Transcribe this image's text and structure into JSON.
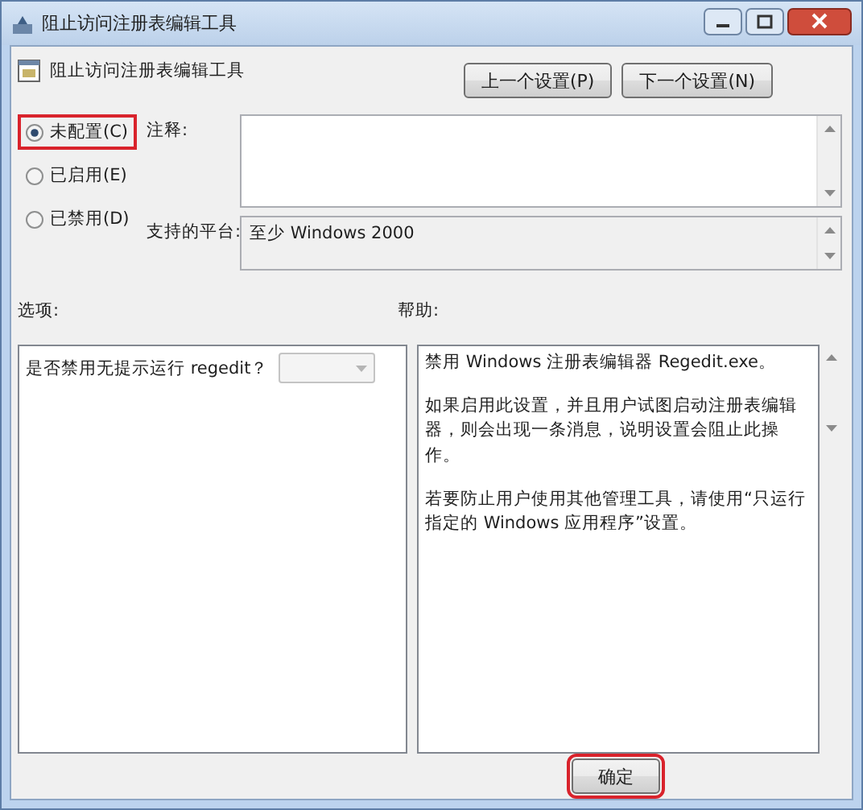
{
  "window": {
    "title": "阻止访问注册表编辑工具"
  },
  "heading": "阻止访问注册表编辑工具",
  "nav_buttons": [
    "上一个设置(P)",
    "下一个设置(N)"
  ],
  "state_options": [
    {
      "label": "未配置(C)",
      "selected": true,
      "highlighted": true
    },
    {
      "label": "已启用(E)",
      "selected": false,
      "highlighted": false
    },
    {
      "label": "已禁用(D)",
      "selected": false,
      "highlighted": false
    }
  ],
  "comment": {
    "label": "注释:"
  },
  "platform": {
    "label": "支持的平台:",
    "value": "至少 Windows 2000"
  },
  "options": {
    "label": "选项:",
    "items": [
      {
        "label": "是否禁用无提示运行 regedit？",
        "disabled": true
      }
    ]
  },
  "help": {
    "label": "帮助:",
    "paragraphs": [
      "禁用 Windows 注册表编辑器 Regedit.exe。",
      "如果启用此设置，并且用户试图启动注册表编辑器，则会出现一条消息，说明设置会阻止此操作。",
      "若要防止用户使用其他管理工具，请使用“只运行指定的 Windows 应用程序”设置。"
    ]
  },
  "buttons": [
    {
      "label": "确定",
      "highlighted": true
    }
  ]
}
